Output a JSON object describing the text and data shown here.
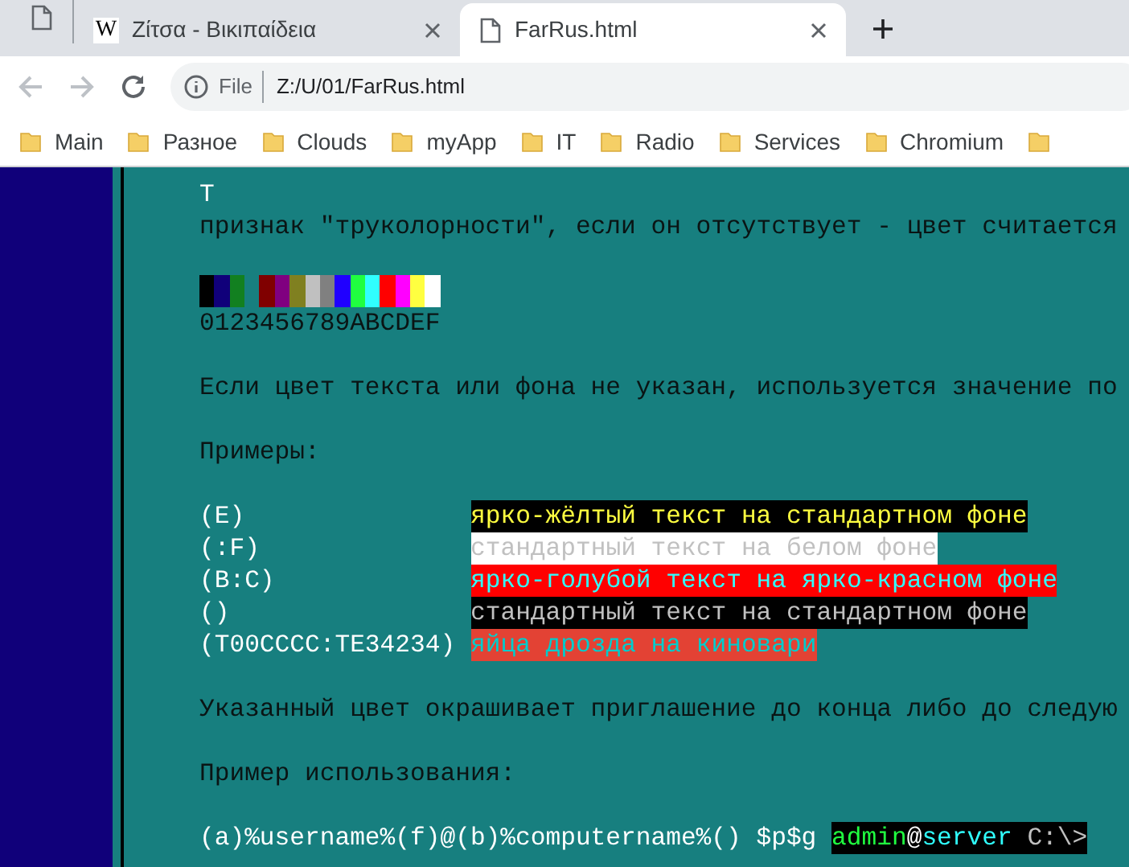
{
  "tabs": [
    {
      "kind": "pinned",
      "selected": false
    },
    {
      "kind": "wiki",
      "favicon": "W",
      "title": "Ζίτσα - Βικιπαίδεια",
      "selected": false
    },
    {
      "kind": "file",
      "title": "FarRus.html",
      "selected": true
    }
  ],
  "toolbar": {
    "back_disabled": true,
    "forward_disabled": true,
    "scheme": "File",
    "url": "Z:/U/01/FarRus.html"
  },
  "bookmarks": [
    "Main",
    "Разное",
    "Clouds",
    "myApp",
    "IT",
    "Radio",
    "Services",
    "Chromium"
  ],
  "bookmarks_overflow_folder": true,
  "lines": [
    {
      "kind": "text",
      "text": "T",
      "color": "#ffffff"
    },
    {
      "kind": "text",
      "text": "признак \"труколорности\", если он отсутствует - цвет считается",
      "color": "#0a1414"
    },
    {
      "kind": "blank"
    },
    {
      "kind": "swatches",
      "swatches": [
        {
          "color": "#000000"
        },
        {
          "color": "#10007a"
        },
        {
          "color": "#128020"
        },
        {
          "color": "#177f7f"
        },
        {
          "color": "#800000"
        },
        {
          "color": "#800080"
        },
        {
          "color": "#808020"
        },
        {
          "color": "#c0c0c0"
        },
        {
          "color": "#808080"
        },
        {
          "color": "#2000ff"
        },
        {
          "color": "#20ff40"
        },
        {
          "color": "#30ffff"
        },
        {
          "color": "#ff0000"
        },
        {
          "color": "#ff00ff"
        },
        {
          "color": "#ffff40"
        },
        {
          "color": "#ffffff"
        }
      ]
    },
    {
      "kind": "text",
      "text": "0123456789ABCDEF",
      "color": "#0a1414"
    },
    {
      "kind": "blank"
    },
    {
      "kind": "text",
      "text": "Если цвет текста или фона не указан, используется значение по",
      "color": "#0a1414"
    },
    {
      "kind": "blank"
    },
    {
      "kind": "text",
      "text": "Примеры:",
      "color": "#0a1414"
    },
    {
      "kind": "blank"
    },
    {
      "kind": "example",
      "code": "(E)",
      "sample": {
        "text": "ярко-жёлтый текст на стандартном фоне",
        "color": "#ffff40"
      },
      "background": {
        "color": "#000000"
      }
    },
    {
      "kind": "example",
      "code": "(:F)",
      "sample": {
        "text": "стандартный текст на белом фоне",
        "color": "#c0c0c0"
      },
      "background": {
        "color": "#ffffff"
      }
    },
    {
      "kind": "example",
      "code": "(B:C)",
      "sample": {
        "text": "ярко-голубой текст на ярко-красном фоне",
        "color": "#30ffff"
      },
      "background": {
        "color": "#ff0000"
      }
    },
    {
      "kind": "example",
      "code": "()",
      "sample": {
        "text": "стандартный текст на стандартном фоне",
        "color": "#c0c0c0"
      },
      "background": {
        "color": "#000000"
      }
    },
    {
      "kind": "example",
      "code": "(T00CCCC:TE34234)",
      "sample": {
        "text": "яйца дрозда на киновари",
        "color": "#00cccc"
      },
      "background": {
        "color": "#e34234"
      }
    },
    {
      "kind": "blank"
    },
    {
      "kind": "text",
      "text": "Указанный цвет окрашивает приглашение до конца либо до следую",
      "color": "#0a1414"
    },
    {
      "kind": "blank"
    },
    {
      "kind": "text",
      "text": "Пример использования:",
      "color": "#0a1414"
    },
    {
      "kind": "blank"
    },
    {
      "kind": "prompt",
      "code": "(a)%username%(f)@(b)%computername%() $p$g",
      "segments": [
        {
          "text": "admin",
          "color": "#20ff40"
        },
        {
          "text": "@",
          "color": "#ffffff"
        },
        {
          "text": "server",
          "color": "#30ffff"
        },
        {
          "text": " C:\\>",
          "color": "#c0c0c0"
        }
      ]
    }
  ]
}
